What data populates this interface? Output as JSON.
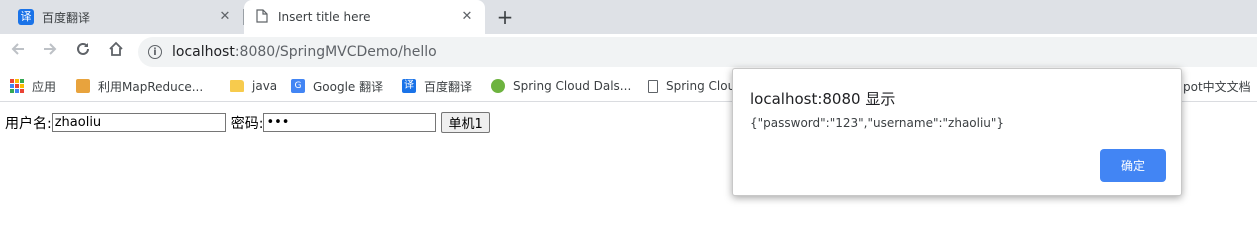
{
  "tabs": [
    {
      "title": "百度翻译",
      "favicon": "baidu-translate-icon",
      "active": false
    },
    {
      "title": "Insert title here",
      "favicon": "document-icon",
      "active": true
    }
  ],
  "toolbar": {
    "url_host": "localhost",
    "url_rest": ":8080/SpringMVCDemo/hello"
  },
  "bookmarks": [
    {
      "label": "应用",
      "icon": "apps-icon"
    },
    {
      "label": "利用MapReduce...",
      "icon": "rss-icon"
    },
    {
      "label": "java",
      "icon": "folder-icon"
    },
    {
      "label": "Google 翻译",
      "icon": "google-translate-icon"
    },
    {
      "label": "百度翻译",
      "icon": "baidu-translate-icon"
    },
    {
      "label": "Spring Cloud Dals...",
      "icon": "spring-icon"
    },
    {
      "label": "Spring Clou",
      "icon": "document-icon"
    },
    {
      "label": "pot中文文档",
      "icon": ""
    }
  ],
  "form": {
    "username_label": "用户名:",
    "username_value": "zhaoliu",
    "password_label": "密码:",
    "password_value": "123",
    "button_label": "单机1"
  },
  "dialog": {
    "title": "localhost:8080 显示",
    "message": "{\"password\":\"123\",\"username\":\"zhaoliu\"}",
    "ok_label": "确定"
  },
  "colors": {
    "accent": "#4285f4",
    "tabstrip": "#dee1e6",
    "omnibox": "#f1f3f4"
  }
}
